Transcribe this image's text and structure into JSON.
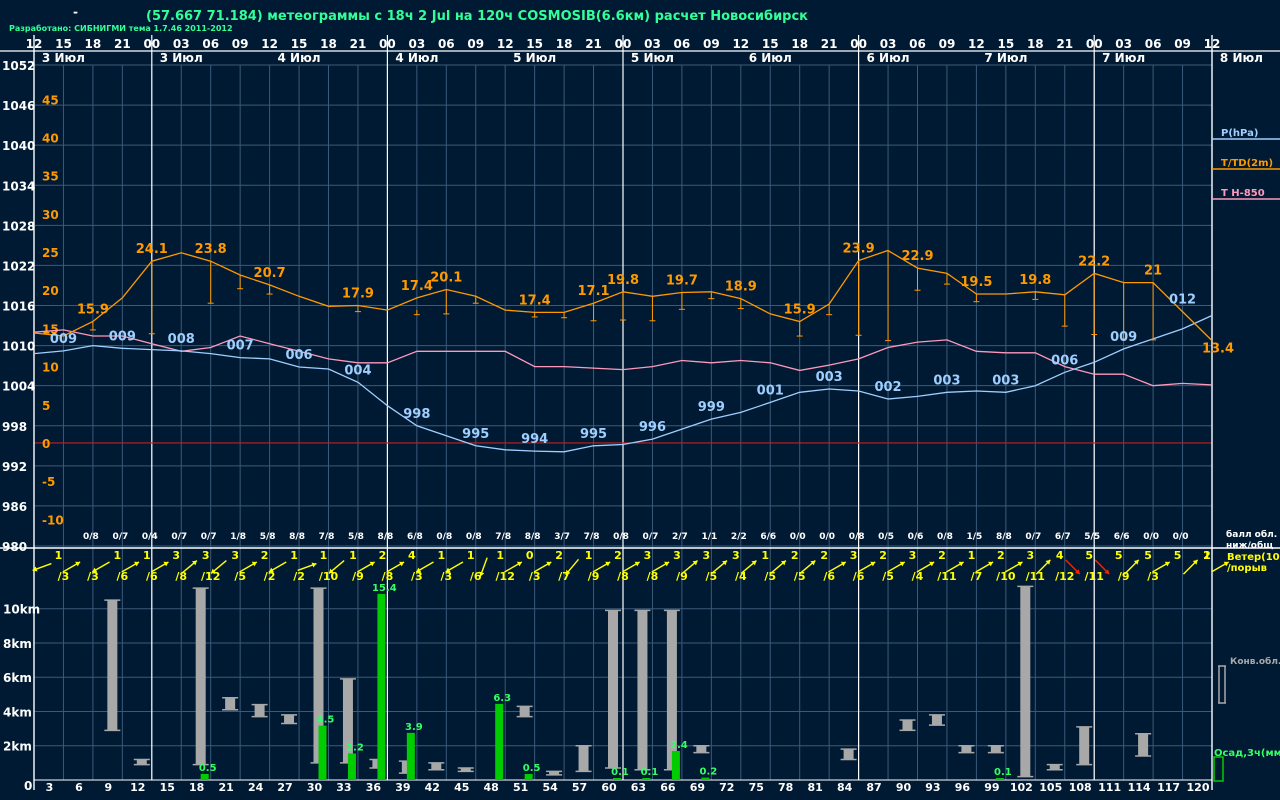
{
  "header": {
    "dash": "-",
    "title": "(57.667 71.184) метеограммы с  18ч 2 Jul на 120ч COSMOSIB(6.6км) расчет Новосибирск",
    "credit": "Разработано: СИБНИГМИ тема 1.7.46 2011-2012"
  },
  "colors": {
    "background": "#001a33",
    "grid": "#3a5a7a",
    "pressure": "#9fcfff",
    "temperature": "#ff9900",
    "t850": "#ff99bb",
    "zero_line": "#c02020",
    "wind": "#ffff00",
    "wind_strong": "#ff2000",
    "cloud": "#a8a8a8",
    "precip": "#00cc00",
    "text": "#ffffff"
  },
  "chart_data": [
    {
      "type": "line",
      "hour_labels": [
        "12",
        "15",
        "18",
        "21",
        "00",
        "03",
        "06",
        "09",
        "12",
        "15",
        "18",
        "21",
        "00",
        "03",
        "06",
        "09",
        "12",
        "15",
        "18",
        "21",
        "00",
        "03",
        "06",
        "09",
        "12",
        "15",
        "18",
        "21",
        "00",
        "03",
        "06",
        "09",
        "12",
        "15",
        "18",
        "21",
        "00",
        "03",
        "06",
        "09",
        "12"
      ],
      "date_labels": [
        "3 Июл",
        "3 Июл",
        "4 Июл",
        "4 Июл",
        "5 Июл",
        "5 Июл",
        "6 Июл",
        "6 Июл",
        "7 Июл",
        "7 Июл",
        "8 Июл"
      ],
      "pressure_ticks": [
        "1052",
        "1046",
        "1040",
        "1034",
        "1028",
        "1022",
        "1016",
        "1010",
        "1004",
        "998",
        "992",
        "986",
        "980"
      ],
      "temperature_ticks": [
        "45",
        "40",
        "35",
        "30",
        "25",
        "20",
        "15",
        "10",
        "5",
        "0",
        "-5",
        "-10"
      ],
      "legend": [
        "P(hPa)",
        "T/TD(2m)",
        "T H-850"
      ],
      "forecast_hours": [
        0,
        3,
        6,
        9,
        12,
        15,
        18,
        21,
        24,
        27,
        30,
        33,
        36,
        39,
        42,
        45,
        48,
        51,
        54,
        57,
        60,
        63,
        66,
        69,
        72,
        75,
        78,
        81,
        84,
        87,
        90,
        93,
        96,
        99,
        102,
        105,
        108,
        111,
        114,
        117,
        120
      ],
      "series": [
        {
          "name": "P(hPa)",
          "values": [
            1008.8,
            1009.2,
            1010.0,
            1009.6,
            1009.4,
            1009.2,
            1008.8,
            1008.2,
            1008.0,
            1006.8,
            1006.5,
            1004.5,
            1001.0,
            998.0,
            996.5,
            995.0,
            994.4,
            994.2,
            994.1,
            995.0,
            995.2,
            996.0,
            997.5,
            999.0,
            1000.0,
            1001.5,
            1003.0,
            1003.5,
            1003.2,
            1002.0,
            1002.4,
            1003.0,
            1003.2,
            1003.0,
            1004.0,
            1006.0,
            1007.5,
            1009.5,
            1011.0,
            1012.5,
            1014.5
          ]
        },
        {
          "name": "T/TD(2m)",
          "values": [
            14.4,
            14.0,
            15.9,
            19.0,
            23.8,
            24.9,
            23.8,
            22.0,
            20.7,
            19.2,
            17.9,
            18.0,
            17.4,
            19.0,
            20.1,
            19.2,
            17.4,
            17.1,
            17.1,
            18.3,
            19.8,
            19.2,
            19.7,
            19.8,
            18.9,
            16.9,
            15.9,
            18.2,
            23.9,
            25.2,
            22.9,
            22.2,
            19.5,
            19.5,
            19.8,
            19.4,
            22.2,
            21.0,
            21.0,
            17.2,
            13.4
          ]
        },
        {
          "name": "T H-850",
          "values": [
            14.5,
            14.8,
            14.0,
            14.0,
            13.0,
            12.0,
            12.5,
            14.0,
            13.0,
            12.0,
            11.0,
            10.5,
            10.5,
            12.0,
            12.0,
            12.0,
            12.0,
            10.0,
            10.0,
            9.8,
            9.6,
            10.0,
            10.8,
            10.5,
            10.8,
            10.5,
            9.5,
            10.2,
            11.0,
            12.5,
            13.2,
            13.5,
            12.0,
            11.8,
            11.8,
            10.0,
            9.0,
            9.0,
            7.5,
            7.8,
            7.6
          ]
        }
      ],
      "temperature_labels": [
        {
          "hour": 6,
          "text": "15.9"
        },
        {
          "hour": 12,
          "text": "24.1"
        },
        {
          "hour": 18,
          "text": "23.8"
        },
        {
          "hour": 24,
          "text": "20.7"
        },
        {
          "hour": 33,
          "text": "17.9"
        },
        {
          "hour": 39,
          "text": "17.4"
        },
        {
          "hour": 42,
          "text": "20.1"
        },
        {
          "hour": 51,
          "text": "17.4"
        },
        {
          "hour": 57,
          "text": "17.1"
        },
        {
          "hour": 60,
          "text": "19.8"
        },
        {
          "hour": 66,
          "text": "19.7"
        },
        {
          "hour": 72,
          "text": "18.9"
        },
        {
          "hour": 78,
          "text": "15.9"
        },
        {
          "hour": 84,
          "text": "23.9"
        },
        {
          "hour": 90,
          "text": "22.9"
        },
        {
          "hour": 96,
          "text": "19.5"
        },
        {
          "hour": 102,
          "text": "19.8"
        },
        {
          "hour": 108,
          "text": "22.2"
        },
        {
          "hour": 114,
          "text": "21"
        },
        {
          "hour": 117,
          "text": "012"
        },
        {
          "hour": 120,
          "text": "13.4"
        }
      ],
      "pressure_labels": [
        {
          "hour": 3,
          "text": "009"
        },
        {
          "hour": 9,
          "text": "009"
        },
        {
          "hour": 15,
          "text": "008"
        },
        {
          "hour": 21,
          "text": "007"
        },
        {
          "hour": 27,
          "text": "006"
        },
        {
          "hour": 33,
          "text": "004"
        },
        {
          "hour": 39,
          "text": "998"
        },
        {
          "hour": 45,
          "text": "995"
        },
        {
          "hour": 51,
          "text": "994"
        },
        {
          "hour": 57,
          "text": "995"
        },
        {
          "hour": 63,
          "text": "996"
        },
        {
          "hour": 69,
          "text": "999"
        },
        {
          "hour": 75,
          "text": "001"
        },
        {
          "hour": 81,
          "text": "003"
        },
        {
          "hour": 87,
          "text": "002"
        },
        {
          "hour": 93,
          "text": "003"
        },
        {
          "hour": 99,
          "text": "003"
        },
        {
          "hour": 105,
          "text": "006"
        },
        {
          "hour": 111,
          "text": "009"
        }
      ],
      "dewpoint_whiskers": [
        {
          "hour": 6,
          "from": 15.9,
          "to": 14.8
        },
        {
          "hour": 12,
          "from": 23.8,
          "to": 14.3
        },
        {
          "hour": 18,
          "from": 23.8,
          "to": 18.3
        },
        {
          "hour": 21,
          "from": 22.0,
          "to": 20.2
        },
        {
          "hour": 24,
          "from": 20.7,
          "to": 19.5
        },
        {
          "hour": 33,
          "from": 17.9,
          "to": 17.2
        },
        {
          "hour": 39,
          "from": 17.4,
          "to": 16.8
        },
        {
          "hour": 42,
          "from": 20.1,
          "to": 16.9
        },
        {
          "hour": 45,
          "from": 19.2,
          "to": 18.3
        },
        {
          "hour": 51,
          "from": 17.1,
          "to": 16.5
        },
        {
          "hour": 54,
          "from": 17.1,
          "to": 16.4
        },
        {
          "hour": 57,
          "from": 18.3,
          "to": 16.0
        },
        {
          "hour": 60,
          "from": 19.8,
          "to": 16.1
        },
        {
          "hour": 63,
          "from": 19.2,
          "to": 16.0
        },
        {
          "hour": 66,
          "from": 19.7,
          "to": 17.5
        },
        {
          "hour": 69,
          "from": 19.8,
          "to": 18.9
        },
        {
          "hour": 72,
          "from": 18.9,
          "to": 17.6
        },
        {
          "hour": 78,
          "from": 15.9,
          "to": 14.0
        },
        {
          "hour": 81,
          "from": 18.2,
          "to": 16.8
        },
        {
          "hour": 84,
          "from": 23.9,
          "to": 14.1
        },
        {
          "hour": 87,
          "from": 25.2,
          "to": 13.4
        },
        {
          "hour": 90,
          "from": 22.9,
          "to": 20.0
        },
        {
          "hour": 93,
          "from": 22.2,
          "to": 20.8
        },
        {
          "hour": 96,
          "from": 19.5,
          "to": 18.5
        },
        {
          "hour": 102,
          "from": 19.8,
          "to": 18.8
        },
        {
          "hour": 105,
          "from": 19.4,
          "to": 15.3
        },
        {
          "hour": 108,
          "from": 22.2,
          "to": 14.2
        },
        {
          "hour": 111,
          "from": 21.0,
          "to": 13.6
        },
        {
          "hour": 114,
          "from": 21.0,
          "to": 13.5
        }
      ],
      "ylim_pressure": [
        980,
        1052
      ],
      "ylim_temperature": [
        -13.5,
        49.5
      ],
      "xlim": [
        0,
        120
      ],
      "grid": true
    },
    {
      "type": "table",
      "title": "балл обл. ниж/общ",
      "title_lines": [
        "балл обл.",
        "ниж/общ"
      ],
      "values": [
        "0/8",
        "0/7",
        "0/4",
        "0/7",
        "0/7",
        "1/8",
        "5/8",
        "8/8",
        "7/8",
        "5/8",
        "8/8",
        "6/8",
        "0/8",
        "0/8",
        "7/8",
        "8/8",
        "3/7",
        "7/8",
        "0/8",
        "0/7",
        "2/7",
        "1/1",
        "2/2",
        "6/6",
        "0/0",
        "0/0",
        "0/8",
        "0/5",
        "0/6",
        "0/8",
        "1/5",
        "8/8",
        "0/7",
        "6/7",
        "5/5",
        "6/6",
        "0/0",
        "0/0"
      ],
      "hours": [
        6,
        9,
        12,
        15,
        18,
        21,
        24,
        27,
        30,
        33,
        36,
        39,
        42,
        45,
        48,
        51,
        54,
        57,
        60,
        63,
        66,
        69,
        72,
        75,
        78,
        81,
        84,
        87,
        90,
        93,
        96,
        99,
        102,
        105,
        108,
        111,
        114,
        117,
        120
      ]
    },
    {
      "type": "table",
      "title": "Ветер(10м)/порыв",
      "title_lines": [
        "Ветер(10м",
        "/порыв"
      ],
      "speeds": [
        "1",
        "1",
        "1",
        "3",
        "3",
        "3",
        "2",
        "1",
        "1",
        "1",
        "2",
        "4",
        "1",
        "1",
        "1",
        "0",
        "2",
        "1",
        "2",
        "3",
        "3",
        "3",
        "3",
        "1",
        "2",
        "2",
        "3",
        "2",
        "3",
        "2",
        "1",
        "2",
        "3",
        "4",
        "5",
        "5",
        "5",
        "5",
        "1",
        "2"
      ],
      "gusts": [
        "/3",
        "/3",
        "/6",
        "/6",
        "/8",
        "/12",
        "/5",
        "/2",
        "/2",
        "/10",
        "/9",
        "/8",
        "/3",
        "/3",
        "/6",
        "/12",
        "/3",
        "/7",
        "/9",
        "/8",
        "/8",
        "/9",
        "/5",
        "/4",
        "/5",
        "/5",
        "/6",
        "/6",
        "/5",
        "/4",
        "/11",
        "/7",
        "/10",
        "/11",
        "/12",
        "/11",
        "/9",
        "/3"
      ],
      "speed_hours": [
        3,
        9,
        12,
        15,
        18,
        21,
        24,
        27,
        30,
        33,
        36,
        39,
        42,
        45,
        48,
        51,
        54,
        57,
        60,
        63,
        66,
        69,
        72,
        75,
        78,
        81,
        84,
        87,
        90,
        93,
        96,
        99,
        102,
        105,
        108,
        111,
        114,
        117,
        120,
        120
      ],
      "gust_hours": [
        3,
        6,
        9,
        12,
        15,
        18,
        21,
        24,
        27,
        30,
        33,
        36,
        39,
        42,
        45,
        48,
        51,
        54,
        57,
        60,
        63,
        66,
        69,
        72,
        75,
        78,
        81,
        84,
        87,
        90,
        93,
        96,
        99,
        102,
        105,
        108,
        111,
        114
      ],
      "directions_deg": [
        250,
        60,
        240,
        60,
        60,
        50,
        230,
        60,
        240,
        70,
        230,
        60,
        60,
        240,
        240,
        200,
        60,
        60,
        220,
        60,
        60,
        60,
        50,
        50,
        50,
        50,
        50,
        60,
        60,
        60,
        60,
        60,
        60,
        60,
        45,
        135,
        135,
        45,
        60,
        45,
        60
      ],
      "strong_hours": [
        105,
        108
      ]
    },
    {
      "type": "bar",
      "title": "Конв.обл.",
      "precip_title": "Осад,3ч(мм)",
      "height_ticks": [
        "10km",
        "8km",
        "6km",
        "4km",
        "2km",
        "0"
      ],
      "hour_ticks": [
        "3",
        "6",
        "9",
        "12",
        "15",
        "18",
        "21",
        "24",
        "27",
        "30",
        "33",
        "36",
        "39",
        "42",
        "45",
        "48",
        "51",
        "54",
        "57",
        "60",
        "63",
        "66",
        "69",
        "72",
        "75",
        "78",
        "81",
        "84",
        "87",
        "90",
        "93",
        "96",
        "99",
        "102",
        "105",
        "108",
        "111",
        "114",
        "117",
        "120"
      ],
      "ylim_km": [
        0,
        11.5
      ],
      "clouds": [
        {
          "hour": 9,
          "base": 2.9,
          "top": 10.5
        },
        {
          "hour": 12,
          "base": 0.9,
          "top": 1.2
        },
        {
          "hour": 18,
          "base": 0.9,
          "top": 11.2
        },
        {
          "hour": 21,
          "base": 4.1,
          "top": 4.8
        },
        {
          "hour": 24,
          "base": 3.7,
          "top": 4.4
        },
        {
          "hour": 27,
          "base": 3.3,
          "top": 3.8
        },
        {
          "hour": 30,
          "base": 1.0,
          "top": 11.2
        },
        {
          "hour": 33,
          "base": 1.0,
          "top": 5.9
        },
        {
          "hour": 36,
          "base": 0.7,
          "top": 1.2
        },
        {
          "hour": 39,
          "base": 0.4,
          "top": 1.1
        },
        {
          "hour": 42,
          "base": 0.6,
          "top": 1.0
        },
        {
          "hour": 45,
          "base": 0.5,
          "top": 0.7
        },
        {
          "hour": 51,
          "base": 3.7,
          "top": 4.3
        },
        {
          "hour": 54,
          "base": 0.3,
          "top": 0.5
        },
        {
          "hour": 57,
          "base": 0.5,
          "top": 2.0
        },
        {
          "hour": 60,
          "base": 0.7,
          "top": 9.9
        },
        {
          "hour": 63,
          "base": 0.6,
          "top": 9.9
        },
        {
          "hour": 66,
          "base": 0.6,
          "top": 9.9
        },
        {
          "hour": 69,
          "base": 1.6,
          "top": 2.0
        },
        {
          "hour": 84,
          "base": 1.2,
          "top": 1.8
        },
        {
          "hour": 90,
          "base": 2.9,
          "top": 3.5
        },
        {
          "hour": 93,
          "base": 3.2,
          "top": 3.8
        },
        {
          "hour": 96,
          "base": 1.6,
          "top": 2.0
        },
        {
          "hour": 99,
          "base": 1.6,
          "top": 2.0
        },
        {
          "hour": 102,
          "base": 0.2,
          "top": 11.3
        },
        {
          "hour": 105,
          "base": 0.6,
          "top": 0.9
        },
        {
          "hour": 108,
          "base": 0.9,
          "top": 3.1
        },
        {
          "hour": 114,
          "base": 1.4,
          "top": 2.7
        }
      ],
      "precip": [
        {
          "hour": 18,
          "value": 0.5,
          "label": "0.5"
        },
        {
          "hour": 30,
          "value": 4.5,
          "label": "4.5"
        },
        {
          "hour": 33,
          "value": 2.2,
          "label": "2.2"
        },
        {
          "hour": 36,
          "value": 15.4,
          "label": "15.4"
        },
        {
          "hour": 39,
          "value": 3.9,
          "label": "3.9"
        },
        {
          "hour": 48,
          "value": 6.3,
          "label": "6.3"
        },
        {
          "hour": 51,
          "value": 0.5,
          "label": "0.5"
        },
        {
          "hour": 60,
          "value": 0.1,
          "label": "0.1"
        },
        {
          "hour": 63,
          "value": 0.1,
          "label": "0.1"
        },
        {
          "hour": 66,
          "value": 2.4,
          "label": "2.4"
        },
        {
          "hour": 69,
          "value": 0.2,
          "label": "0.2"
        },
        {
          "hour": 99,
          "value": 0.1,
          "label": "0.1"
        }
      ],
      "precip_max_mm": 16.3
    }
  ]
}
